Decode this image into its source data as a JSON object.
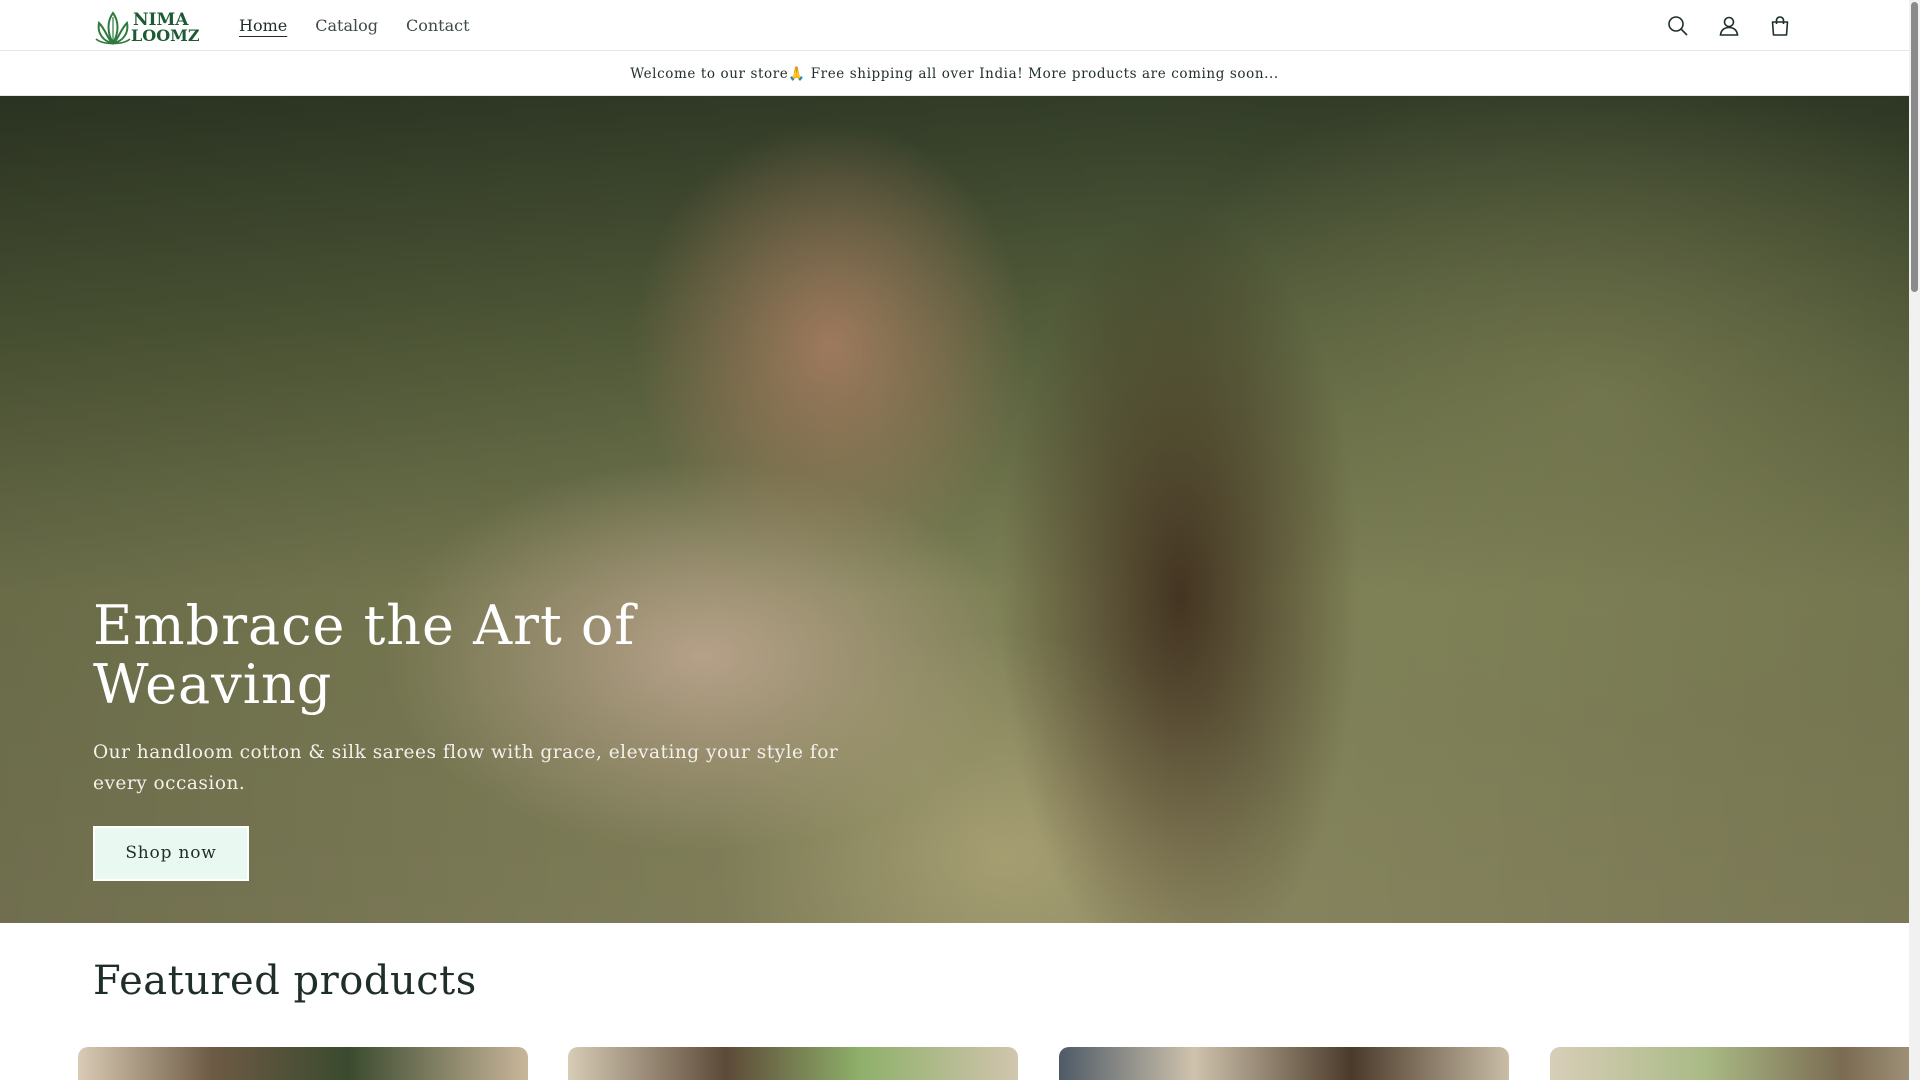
{
  "header": {
    "logo": {
      "line1": "NIMA",
      "line2": "LOOMZ",
      "icon": "lotus-leaf-logo"
    },
    "nav": [
      {
        "label": "Home",
        "active": true
      },
      {
        "label": "Catalog",
        "active": false
      },
      {
        "label": "Contact",
        "active": false
      }
    ],
    "icons": [
      "search-icon",
      "account-icon",
      "cart-icon"
    ]
  },
  "announcement": {
    "text": "Welcome to our store🙏 Free shipping all over India! More products are coming soon..."
  },
  "hero": {
    "title": "Embrace the Art of Weaving",
    "subtitle": "Our handloom cotton & silk sarees flow with grace, elevating your style for every occasion.",
    "button_label": "Shop now"
  },
  "featured": {
    "title": "Featured products",
    "cards": [
      {
        "image": "product-photo-1"
      },
      {
        "image": "product-photo-2"
      },
      {
        "image": "product-photo-3"
      },
      {
        "image": "product-photo-4"
      }
    ]
  },
  "colors": {
    "brand_green": "#1c5a33",
    "text": "#1f2e29",
    "button_bg": "#eaf8f2"
  }
}
